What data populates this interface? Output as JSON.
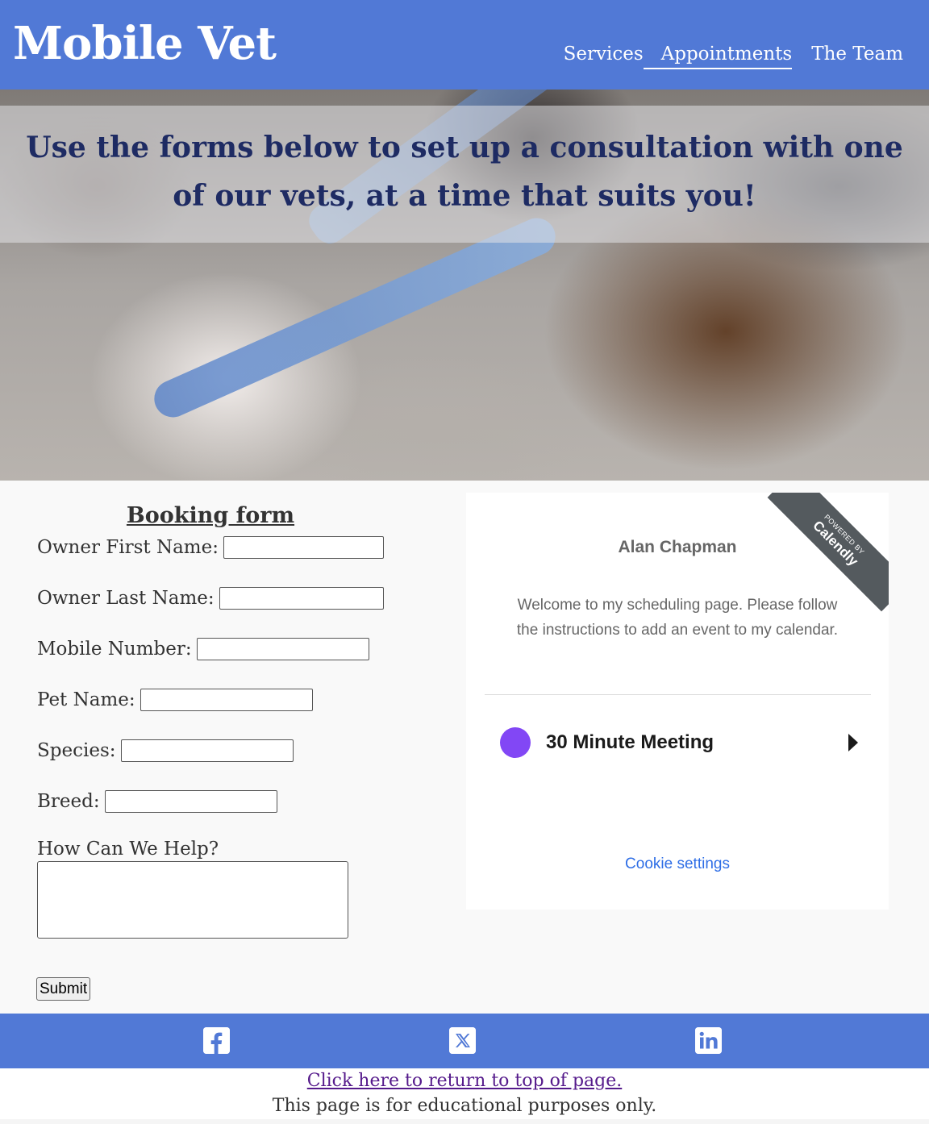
{
  "header": {
    "logo": "Mobile Vet",
    "nav": [
      {
        "label": "Services"
      },
      {
        "label": "Appointments"
      },
      {
        "label": "The Team"
      }
    ]
  },
  "hero": {
    "text": "Use the forms below to set up a consultation with one of our vets, at a time that suits you!"
  },
  "booking": {
    "title": "Booking form",
    "fields": [
      {
        "label": "Owner First Name:",
        "value": ""
      },
      {
        "label": "Owner Last Name:",
        "value": ""
      },
      {
        "label": "Mobile Number:",
        "value": ""
      },
      {
        "label": "Pet Name:",
        "value": ""
      },
      {
        "label": "Species:",
        "value": ""
      },
      {
        "label": "Breed:",
        "value": ""
      }
    ],
    "help_label": "How Can We Help?",
    "submit_label": "Submit"
  },
  "calendly": {
    "ribbon_small": "POWERED BY",
    "ribbon_brand": "Calendly",
    "host": "Alan Chapman",
    "welcome": "Welcome to my scheduling page. Please follow the instructions to add an event to my calendar.",
    "event_name": "30 Minute Meeting",
    "event_color": "#8247f5",
    "cookie_settings": "Cookie settings"
  },
  "footer": {
    "icons": [
      "facebook-icon",
      "x-twitter-icon",
      "linkedin-icon"
    ],
    "top_link": "Click here to return to top of page.",
    "note": "This page is for educational purposes only."
  },
  "colors": {
    "brand": "#5179d6",
    "hero_text": "#1e2b63",
    "link_visited": "#551a8b",
    "cookie_link": "#2e6ee6"
  }
}
